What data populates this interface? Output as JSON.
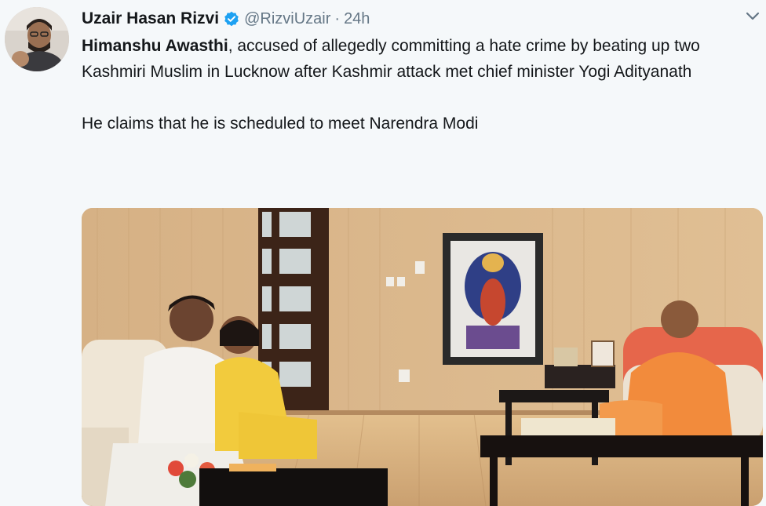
{
  "tweet": {
    "author_name": "Uzair Hasan Rizvi",
    "handle": "@RizviUzair",
    "separator": "·",
    "time": "24h",
    "text_bold": "Himanshu Awasthi",
    "text_rest": ", accused of allegedly committing a hate crime by beating up two Kashmiri Muslim in Lucknow after Kashmir attack met chief minister Yogi Adityanath",
    "text_second": "He claims that he is scheduled to meet Narendra Modi"
  },
  "icons": {
    "verified": "verified-badge-icon",
    "caret": "chevron-down-icon"
  },
  "colors": {
    "verified_blue": "#1da1f2",
    "secondary_text": "#657786",
    "primary_text": "#14171a"
  }
}
